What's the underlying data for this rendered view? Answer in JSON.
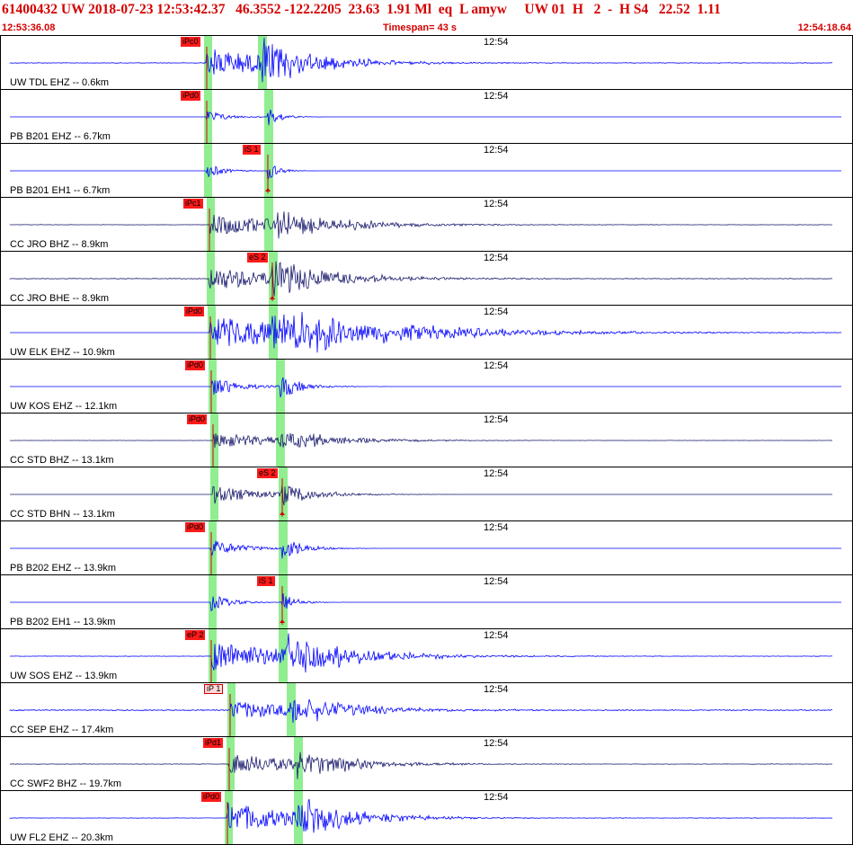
{
  "header": {
    "event_line": "61400432 UW 2018-07-23 12:53:42.37   46.3552 -122.2205  23.63  1.91 Ml  eq  L amyw     UW 01  H   2  -  H S4   22.52  1.11",
    "time_start": "12:53:36.08",
    "timespan": "Timespan=  43 s",
    "time_end": "12:54:18.64"
  },
  "tick_label": "12:54",
  "colors": {
    "title": "#d40000",
    "trace_uw_pb": "#0000ff",
    "trace_cc": "#1a1a6e",
    "pick_band": "#90ee90",
    "pick_flag": "#ff1a1a",
    "pick_flag_light": "#ffd9d9"
  },
  "channels": [
    {
      "label": "UW TDL EHZ -- 0.6km",
      "color": "blue",
      "amp": 1.0,
      "noise": 0.03,
      "decay": 0.012,
      "p": 229,
      "s": 290,
      "pick": "iPc0",
      "pick_s": null
    },
    {
      "label": "PB B201 EHZ -- 6.7km",
      "color": "blue",
      "amp": 0.45,
      "noise": 0.0,
      "decay": 0.05,
      "p": 229,
      "s": 297,
      "pick": "iPd0",
      "pick_s": null
    },
    {
      "label": "PB B201 EH1 -- 6.7km",
      "color": "blue",
      "amp": 0.5,
      "noise": 0.0,
      "decay": 0.06,
      "p": 229,
      "s": 297,
      "pick": null,
      "pick_s": "iS 1"
    },
    {
      "label": "CC JRO BHZ -- 8.9km",
      "color": "dark",
      "amp": 0.7,
      "noise": 0.02,
      "decay": 0.01,
      "p": 232,
      "s": 297,
      "pick": "iPc1",
      "pick_s": null
    },
    {
      "label": "CC JRO BHE -- 8.9km",
      "color": "dark",
      "amp": 0.75,
      "noise": 0.03,
      "decay": 0.01,
      "p": 232,
      "s": 302,
      "pick": null,
      "pick_s": "eS 2"
    },
    {
      "label": "UW ELK EHZ -- 10.9km",
      "color": "blue",
      "amp": 1.0,
      "noise": 0.0,
      "decay": 0.006,
      "p": 233,
      "s": 302,
      "pick": "iPd0",
      "pick_s": null
    },
    {
      "label": "UW KOS EHZ -- 12.1km",
      "color": "blue",
      "amp": 0.6,
      "noise": 0.0,
      "decay": 0.03,
      "p": 234,
      "s": 310,
      "pick": "iPd0",
      "pick_s": null
    },
    {
      "label": "CC STD BHZ -- 13.1km",
      "color": "dark",
      "amp": 0.5,
      "noise": 0.01,
      "decay": 0.012,
      "p": 236,
      "s": 310,
      "pick": "iPd0",
      "pick_s": null
    },
    {
      "label": "CC STD BHN -- 13.1km",
      "color": "dark",
      "amp": 0.6,
      "noise": 0.0,
      "decay": 0.02,
      "p": 236,
      "s": 313,
      "pick": null,
      "pick_s": "eS 2"
    },
    {
      "label": "PB B202 EHZ -- 13.9km",
      "color": "blue",
      "amp": 0.55,
      "noise": 0.0,
      "decay": 0.03,
      "p": 234,
      "s": 313,
      "pick": "iPd0",
      "pick_s": null
    },
    {
      "label": "PB B202 EH1 -- 13.9km",
      "color": "blue",
      "amp": 0.55,
      "noise": 0.0,
      "decay": 0.05,
      "p": 234,
      "s": 313,
      "pick": null,
      "pick_s": "iS 1"
    },
    {
      "label": "UW SOS EHZ -- 13.9km",
      "color": "blue",
      "amp": 1.0,
      "noise": 0.02,
      "decay": 0.01,
      "p": 234,
      "s": 313,
      "pick": "eP 2",
      "pick_s": null
    },
    {
      "label": "CC SEP EHZ -- 17.4km",
      "color": "blue",
      "amp": 0.6,
      "noise": 0.05,
      "decay": 0.01,
      "p": 255,
      "s": 322,
      "pick": "iP 1",
      "pick_s": null
    },
    {
      "label": "CC SWF2 BHZ -- 19.7km",
      "color": "dark",
      "amp": 0.7,
      "noise": 0.02,
      "decay": 0.012,
      "p": 254,
      "s": 330,
      "pick": "iPd1",
      "pick_s": null
    },
    {
      "label": "UW FL2 EHZ -- 20.3km",
      "color": "blue",
      "amp": 1.0,
      "noise": 0.02,
      "decay": 0.012,
      "p": 252,
      "s": 330,
      "pick": "iPd0",
      "pick_s": null
    }
  ]
}
